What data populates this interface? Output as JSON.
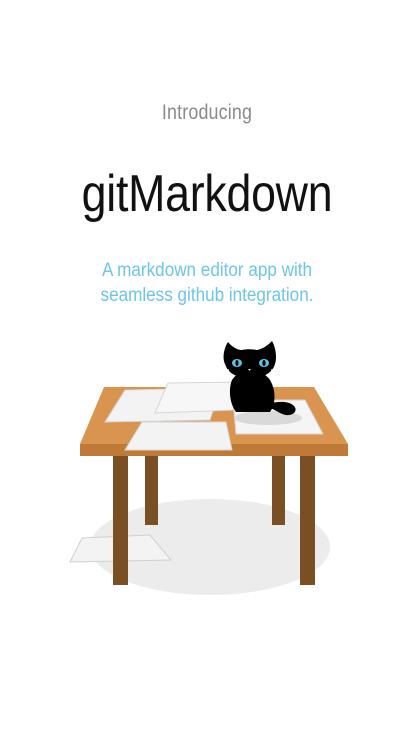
{
  "onboarding": {
    "intro": "Introducing",
    "title": "gitMarkdown",
    "subtitle_line1": "A markdown editor app with",
    "subtitle_line2": "seamless github integration."
  },
  "colors": {
    "intro": "#8a8a8a",
    "title": "#111111",
    "subtitle": "#6cc6ea",
    "table_top": "#d9944f",
    "table_legs": "#7a4f24",
    "cat": "#000000",
    "cat_eyes": "#5fc3e4",
    "paper": "#f3f3f3",
    "shadow": "#ececec"
  },
  "icons": {
    "illustration": "cat-on-desk-illustration"
  }
}
